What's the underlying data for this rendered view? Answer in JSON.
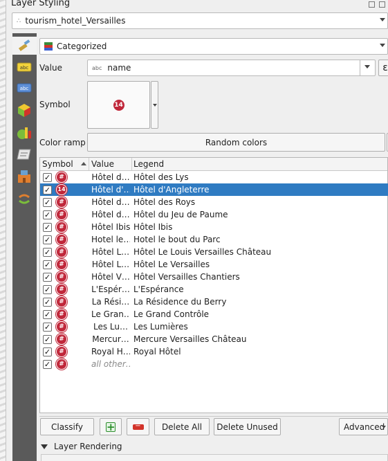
{
  "panel": {
    "title": "Layer Styling"
  },
  "layer_select": {
    "value": "tourism_hotel_Versailles"
  },
  "renderer_select": {
    "value": "Categorized"
  },
  "value_field": {
    "label": "Value",
    "type_badge": "abc",
    "value": "name"
  },
  "symbol": {
    "label": "Symbol",
    "preview_text": "14"
  },
  "color_ramp": {
    "label": "Color ramp",
    "value": "Random colors"
  },
  "table": {
    "headers": {
      "symbol": "Symbol",
      "value": "Value",
      "legend": "Legend"
    },
    "rows": [
      {
        "value": "Hôtel d…",
        "legend": "Hôtel des Lys",
        "symbol": "#",
        "checked": true
      },
      {
        "value": "Hôtel d'…",
        "legend": "Hôtel d'Angleterre",
        "symbol": "14",
        "checked": true,
        "selected": true
      },
      {
        "value": "Hôtel d…",
        "legend": "Hôtel des Roys",
        "symbol": "#",
        "checked": true
      },
      {
        "value": "Hôtel d…",
        "legend": "Hôtel du Jeu de Paume",
        "symbol": "#",
        "checked": true
      },
      {
        "value": "Hôtel Ibis",
        "legend": "Hôtel Ibis",
        "symbol": "#",
        "checked": true
      },
      {
        "value": "Hotel le…",
        "legend": "Hotel le bout du Parc",
        "symbol": "#",
        "checked": true
      },
      {
        "value": "Hôtel L…",
        "legend": "Hôtel Le Louis Versailles Château",
        "symbol": "#",
        "checked": true
      },
      {
        "value": "Hôtel L…",
        "legend": "Hôtel Le Versailles",
        "symbol": "#",
        "checked": true
      },
      {
        "value": "Hôtel V…",
        "legend": "Hôtel Versailles Chantiers",
        "symbol": "#",
        "checked": true
      },
      {
        "value": "L'Espér…",
        "legend": "L'Espérance",
        "symbol": "#",
        "checked": true
      },
      {
        "value": "La Rési…",
        "legend": "La Résidence du Berry",
        "symbol": "#",
        "checked": true
      },
      {
        "value": "Le Gran…",
        "legend": "Le Grand Contrôle",
        "symbol": "#",
        "checked": true
      },
      {
        "value": "Les Lu…",
        "legend": "Les Lumières",
        "symbol": "#",
        "checked": true
      },
      {
        "value": "Mercur…",
        "legend": "Mercure Versailles Château",
        "symbol": "#",
        "checked": true
      },
      {
        "value": "Royal H…",
        "legend": "Royal Hôtel",
        "symbol": "#",
        "checked": true
      },
      {
        "value": "all other…",
        "legend": "",
        "symbol": "#",
        "checked": true,
        "other": true
      }
    ]
  },
  "buttons": {
    "classify": "Classify",
    "add": "+",
    "remove": "−",
    "delete_all": "Delete All",
    "delete_unused": "Delete Unused",
    "advanced": "Advanced"
  },
  "layer_rendering": {
    "label": "Layer Rendering"
  },
  "colors": {
    "accent": "#2f7bc2",
    "marker": "#c0273a"
  }
}
